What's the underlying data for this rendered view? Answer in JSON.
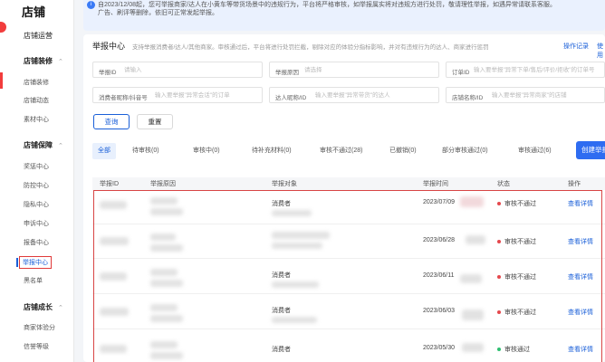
{
  "sidebar": {
    "brand": "店铺",
    "top_item": "店铺运营",
    "groups": [
      {
        "label": "店铺装修",
        "items": [
          "店铺装修",
          "店铺动态",
          "素材中心"
        ]
      },
      {
        "label": "店铺保障",
        "items": [
          "奖惩中心",
          "防控中心",
          "隐私中心",
          "申诉中心",
          "报备中心",
          "举报中心",
          "黑名单"
        ]
      },
      {
        "label": "店铺成长",
        "items": [
          "商家体验分",
          "信誉等级"
        ]
      }
    ],
    "active_item": "举报中心"
  },
  "notice": {
    "icon": "info-icon",
    "line1": "自2023/12/08起，您可举报商家/达人在小黄车等带货场景中的违规行为，平台将严格审核，如举报属实将对违规方进行处罚，敬请理性举报，如遇异常请联系客服。",
    "line2": "广告、刷评等删除，依旧可正常发起举报。"
  },
  "header": {
    "title": "举报中心",
    "desc": "支持举报消费者/达人/其他商家。审核通过后，平台将进行处罚拦截，剔除对应的体验分指标影响，并对有违规行为的达人、商家进行惩罚",
    "records_link": "操作记录",
    "help_link": "使用"
  },
  "filters": {
    "report_id": {
      "label": "举报ID",
      "placeholder": "请输入"
    },
    "reason": {
      "label": "举报原因",
      "placeholder": "请选择"
    },
    "order_id": {
      "label": "订单ID",
      "placeholder": "输入要举报\"异常下单/售后/评价/拒收\"的订单号"
    },
    "consumer": {
      "label": "消费者昵称/抖音号",
      "placeholder": "输入要举报\"异常会话\"的订单"
    },
    "influencer": {
      "label": "达人昵称/ID",
      "placeholder": "输入要举报\"异常带货\"的达人"
    },
    "shop": {
      "label": "店铺名称/ID",
      "placeholder": "输入要举报\"异常商家\"的店铺"
    }
  },
  "buttons": {
    "query": "查询",
    "reset": "重置",
    "create": "创建举报"
  },
  "tabs": [
    {
      "label": "全部"
    },
    {
      "label": "待审核(0)"
    },
    {
      "label": "审核中(0)"
    },
    {
      "label": "待补充材料(0)"
    },
    {
      "label": "审核不通过(28)"
    },
    {
      "label": "已撤销(0)"
    },
    {
      "label": "部分审核通过(0)"
    },
    {
      "label": "审核通过(6)"
    }
  ],
  "table": {
    "columns": [
      "举报ID",
      "举报原因",
      "举报对象",
      "举报时间",
      "状态",
      "操作"
    ],
    "rows": [
      {
        "target": "消费者",
        "time": "2023/07/09",
        "status": "审核不通过",
        "status_color": "#e5484d",
        "action": "查看详情"
      },
      {
        "target": "消费者",
        "time": "2023/06/28",
        "status": "审核不通过",
        "status_color": "#e5484d",
        "action": "查看详情"
      },
      {
        "target": "消费者",
        "time": "2023/06/11",
        "status": "审核不通过",
        "status_color": "#e5484d",
        "action": "查看详情"
      },
      {
        "target": "消费者",
        "time": "2023/06/03",
        "status": "审核不通过",
        "status_color": "#e5484d",
        "action": "查看详情"
      },
      {
        "target": "消费者",
        "time": "2023/05/30",
        "status": "审核通过",
        "status_color": "#2fbf71",
        "action": "查看详情"
      }
    ]
  },
  "colors": {
    "accent": "#1a5fd8",
    "primary_button": "#2e6cf1",
    "highlight_border": "#d84545"
  }
}
